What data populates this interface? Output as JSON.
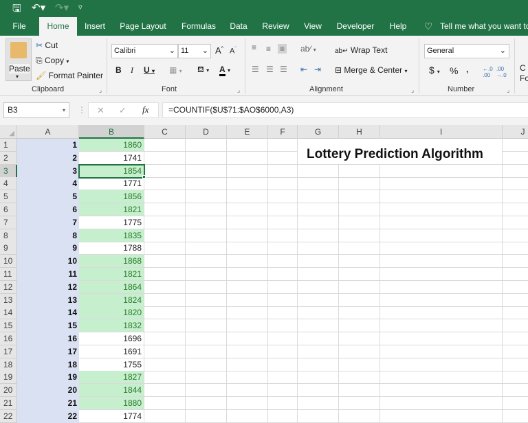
{
  "quick_access": {
    "save_icon": "save-icon",
    "undo_icon": "undo-icon",
    "redo_icon": "redo-icon",
    "customize_icon": "customize-qat-icon"
  },
  "tabs": [
    {
      "label": "File"
    },
    {
      "label": "Home",
      "active": true
    },
    {
      "label": "Insert"
    },
    {
      "label": "Page Layout"
    },
    {
      "label": "Formulas"
    },
    {
      "label": "Data"
    },
    {
      "label": "Review"
    },
    {
      "label": "View"
    },
    {
      "label": "Developer"
    },
    {
      "label": "Help"
    }
  ],
  "tell_me": "Tell me what you want to",
  "ribbon": {
    "clipboard": {
      "label": "Clipboard",
      "paste": "Paste",
      "cut": "Cut",
      "copy": "Copy",
      "format_painter": "Format Painter"
    },
    "font": {
      "label": "Font",
      "font_name": "Calibri",
      "font_size": "11",
      "bold": "B",
      "italic": "I",
      "underline": "U",
      "grow": "A",
      "shrink": "A",
      "font_color": "A"
    },
    "alignment": {
      "label": "Alignment",
      "wrap_text": "Wrap Text",
      "merge_center": "Merge & Center"
    },
    "number": {
      "label": "Number",
      "format": "General",
      "currency": "$",
      "percent": "%",
      "comma": ",",
      "inc_decimal": "+.0 .00",
      "dec_decimal": ".00 →.0"
    },
    "partial": {
      "line1": "C",
      "line2": "Fo"
    }
  },
  "formula_bar": {
    "name_box": "B3",
    "cancel": "✕",
    "enter": "✓",
    "fx": "fx",
    "formula": "=COUNTIF($U$71:$AO$6000,A3)"
  },
  "columns": [
    "A",
    "B",
    "C",
    "D",
    "E",
    "F",
    "G",
    "H",
    "I",
    "J"
  ],
  "selected_cell": "B3",
  "title_cell": "Lottery Prediction Algorithm",
  "rows": [
    {
      "row": "1",
      "a": "1",
      "b": "1860",
      "hl": true
    },
    {
      "row": "2",
      "a": "2",
      "b": "1741",
      "hl": false
    },
    {
      "row": "3",
      "a": "3",
      "b": "1854",
      "hl": true
    },
    {
      "row": "4",
      "a": "4",
      "b": "1771",
      "hl": false
    },
    {
      "row": "5",
      "a": "5",
      "b": "1856",
      "hl": true
    },
    {
      "row": "6",
      "a": "6",
      "b": "1821",
      "hl": true
    },
    {
      "row": "7",
      "a": "7",
      "b": "1775",
      "hl": false
    },
    {
      "row": "8",
      "a": "8",
      "b": "1835",
      "hl": true
    },
    {
      "row": "9",
      "a": "9",
      "b": "1788",
      "hl": false
    },
    {
      "row": "10",
      "a": "10",
      "b": "1868",
      "hl": true
    },
    {
      "row": "11",
      "a": "11",
      "b": "1821",
      "hl": true
    },
    {
      "row": "12",
      "a": "12",
      "b": "1864",
      "hl": true
    },
    {
      "row": "13",
      "a": "13",
      "b": "1824",
      "hl": true
    },
    {
      "row": "14",
      "a": "14",
      "b": "1820",
      "hl": true
    },
    {
      "row": "15",
      "a": "15",
      "b": "1832",
      "hl": true
    },
    {
      "row": "16",
      "a": "16",
      "b": "1696",
      "hl": false
    },
    {
      "row": "17",
      "a": "17",
      "b": "1691",
      "hl": false
    },
    {
      "row": "18",
      "a": "18",
      "b": "1755",
      "hl": false
    },
    {
      "row": "19",
      "a": "19",
      "b": "1827",
      "hl": true
    },
    {
      "row": "20",
      "a": "20",
      "b": "1844",
      "hl": true
    },
    {
      "row": "21",
      "a": "21",
      "b": "1880",
      "hl": true
    },
    {
      "row": "22",
      "a": "22",
      "b": "1774",
      "hl": false
    }
  ]
}
